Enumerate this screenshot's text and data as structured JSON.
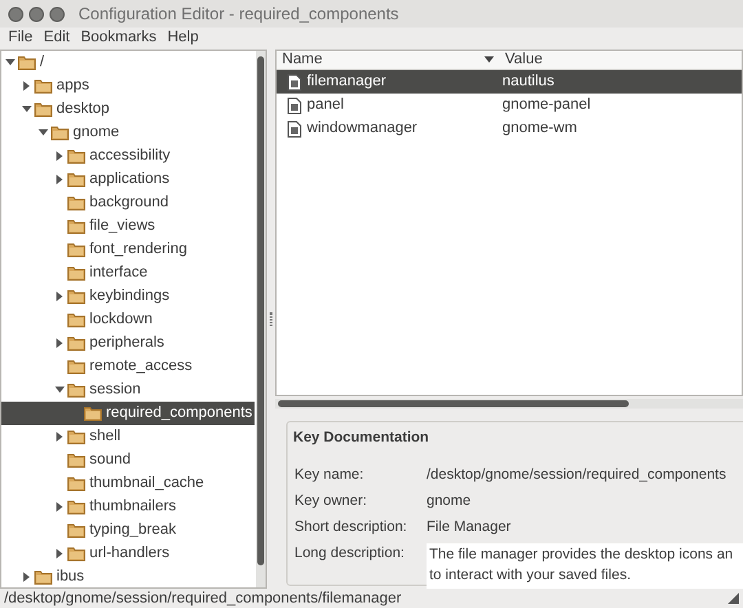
{
  "window": {
    "title": "Configuration Editor - required_components"
  },
  "menu": [
    "File",
    "Edit",
    "Bookmarks",
    "Help"
  ],
  "tree": [
    {
      "label": "/",
      "expanded": true,
      "selected": false,
      "children": [
        {
          "label": "apps",
          "expanded": false,
          "selected": false
        },
        {
          "label": "desktop",
          "expanded": true,
          "selected": false,
          "children": [
            {
              "label": "gnome",
              "expanded": true,
              "selected": false,
              "children": [
                {
                  "label": "accessibility",
                  "expanded": false,
                  "selected": false
                },
                {
                  "label": "applications",
                  "expanded": false,
                  "selected": false
                },
                {
                  "label": "background",
                  "selected": false
                },
                {
                  "label": "file_views",
                  "selected": false
                },
                {
                  "label": "font_rendering",
                  "selected": false
                },
                {
                  "label": "interface",
                  "selected": false
                },
                {
                  "label": "keybindings",
                  "expanded": false,
                  "selected": false
                },
                {
                  "label": "lockdown",
                  "selected": false
                },
                {
                  "label": "peripherals",
                  "expanded": false,
                  "selected": false
                },
                {
                  "label": "remote_access",
                  "selected": false
                },
                {
                  "label": "session",
                  "expanded": true,
                  "selected": false,
                  "children": [
                    {
                      "label": "required_components",
                      "selected": true
                    }
                  ]
                },
                {
                  "label": "shell",
                  "expanded": false,
                  "selected": false
                },
                {
                  "label": "sound",
                  "selected": false
                },
                {
                  "label": "thumbnail_cache",
                  "selected": false
                },
                {
                  "label": "thumbnailers",
                  "expanded": false,
                  "selected": false
                },
                {
                  "label": "typing_break",
                  "selected": false
                },
                {
                  "label": "url-handlers",
                  "expanded": false,
                  "selected": false
                }
              ]
            }
          ]
        },
        {
          "label": "ibus",
          "expanded": false,
          "selected": false
        }
      ]
    }
  ],
  "table": {
    "columns": [
      {
        "label": "Name",
        "sorted": true
      },
      {
        "label": "Value",
        "sorted": false
      }
    ],
    "rows": [
      {
        "name": "filemanager",
        "value": "nautilus",
        "selected": true
      },
      {
        "name": "panel",
        "value": "gnome-panel",
        "selected": false
      },
      {
        "name": "windowmanager",
        "value": "gnome-wm",
        "selected": false
      }
    ]
  },
  "key_documentation": {
    "title": "Key Documentation",
    "fields": [
      {
        "label": "Key name:",
        "value": "/desktop/gnome/session/required_components"
      },
      {
        "label": "Key owner:",
        "value": "gnome"
      },
      {
        "label": "Short description:",
        "value": "File Manager"
      }
    ],
    "long_description": {
      "label": "Long description:",
      "lines": [
        "The file manager provides the desktop icons an",
        "to interact with your saved files."
      ]
    }
  },
  "status_bar": "/desktop/gnome/session/required_components/filemanager"
}
